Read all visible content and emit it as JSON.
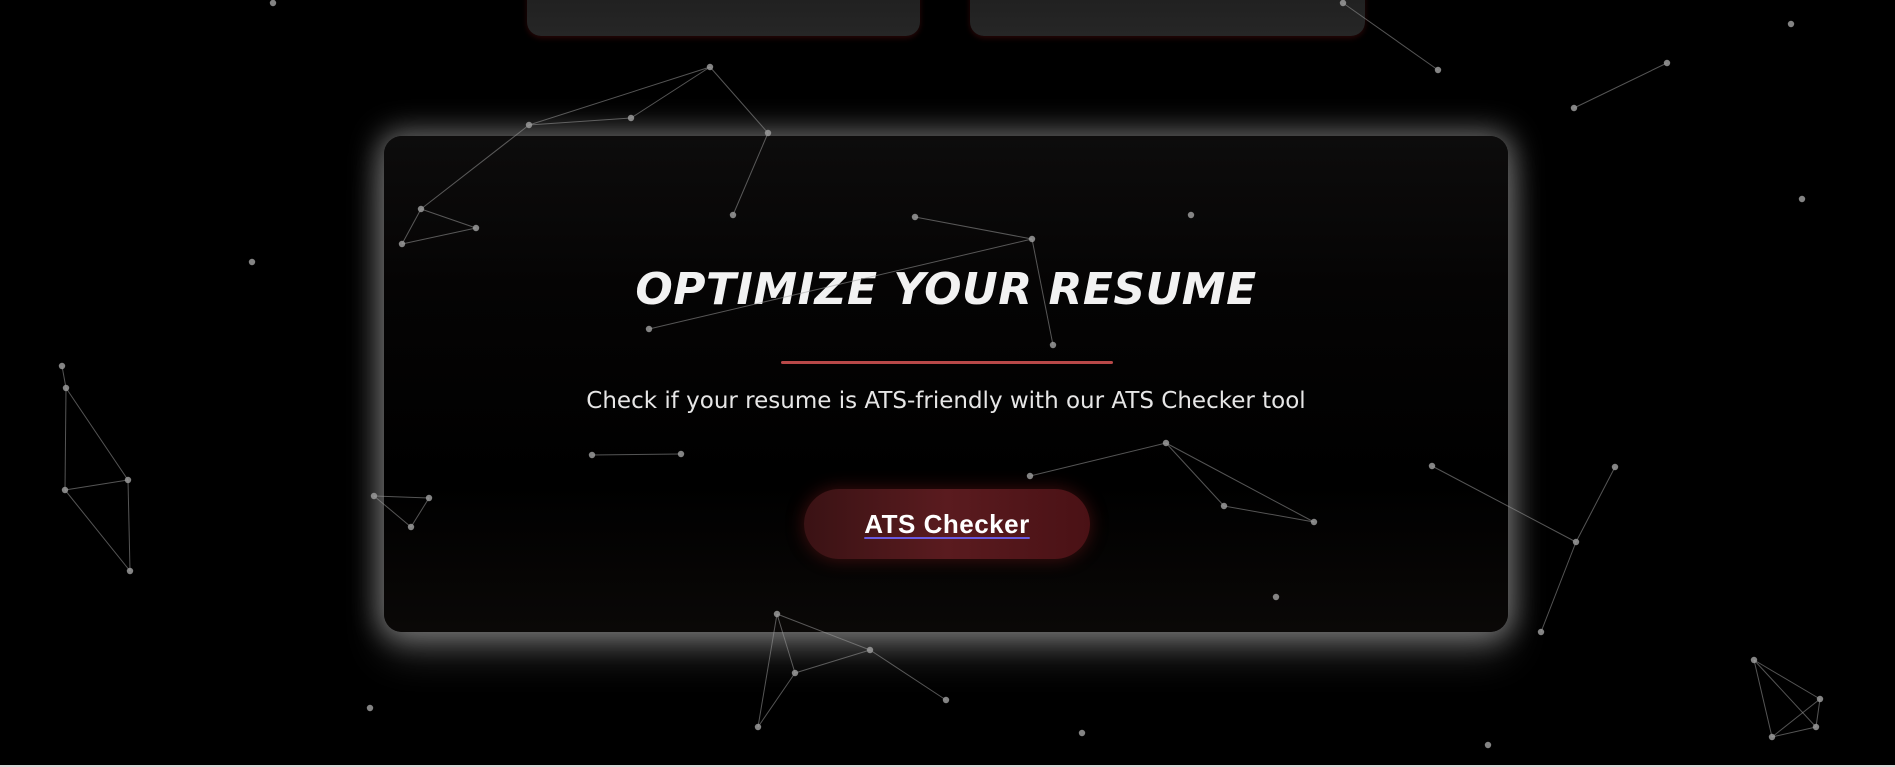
{
  "hero": {
    "title": "OPTIMIZE YOUR RESUME",
    "subtitle": "Check if your resume is ATS-friendly with our ATS Checker tool",
    "button_label": "ATS Checker"
  },
  "colors": {
    "background": "#000000",
    "accent": "#b84848",
    "button": "#5a1b1f",
    "network": "#9a9a9a"
  }
}
